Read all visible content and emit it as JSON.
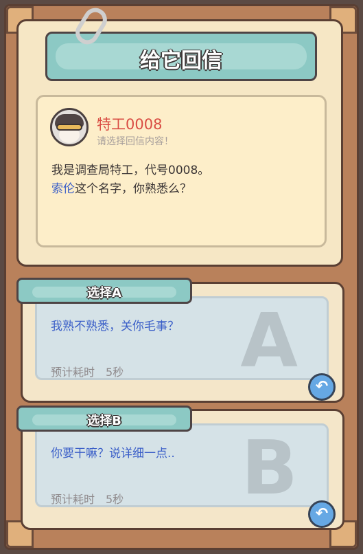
{
  "header": {
    "title": "给它回信"
  },
  "letter": {
    "sender": "特工0008",
    "prompt": "请选择回信内容！",
    "line1": "我是调查局特工，代号0008。",
    "highlight": "索伦",
    "line2_rest": "这个名字，你熟悉么？"
  },
  "options": [
    {
      "tab": "选择A",
      "letter": "A",
      "text": "我熟不熟悉，关你毛事？",
      "time": "预计耗时　5秒",
      "reply_icon": "↶"
    },
    {
      "tab": "选择B",
      "letter": "B",
      "text": "你要干嘛？说详细一点..",
      "time": "预计耗时　5秒",
      "reply_icon": "↶"
    }
  ],
  "colors": {
    "teal": "#8cc9c4",
    "paper": "#f6e7c5",
    "name_red": "#d94d44",
    "link_blue": "#3b5fc8",
    "reply_blue": "#66a8e4"
  }
}
